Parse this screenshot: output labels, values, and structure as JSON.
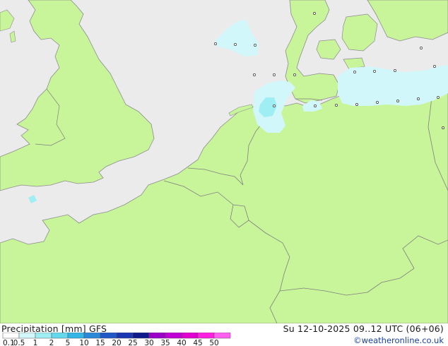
{
  "title": {
    "product": "Precipitation [mm]",
    "model": "GFS",
    "datetime": "Su 12-10-2025 09..12 UTC (06+06)"
  },
  "credit": "©weatheronline.co.uk",
  "colors": {
    "sea": "#ebebeb",
    "land": "#c8f59a",
    "border": "#7f7f7f",
    "coast": "#8c8c8c",
    "precip_light": "#d2f7fb",
    "precip_medium": "#9eeef3"
  },
  "legend": {
    "labels": [
      "0.1",
      "0.5",
      "1",
      "2",
      "5",
      "10",
      "15",
      "20",
      "25",
      "30",
      "35",
      "40",
      "45",
      "50"
    ],
    "colors": [
      "#ffffff",
      "#d2f7fb",
      "#9eeef3",
      "#64d8ec",
      "#31b6e6",
      "#2a88d8",
      "#2058c8",
      "#1a36b0",
      "#0e1a8c",
      "#9a00c8",
      "#c000d4",
      "#e000d0",
      "#ff20e0",
      "#ff60f0"
    ]
  }
}
